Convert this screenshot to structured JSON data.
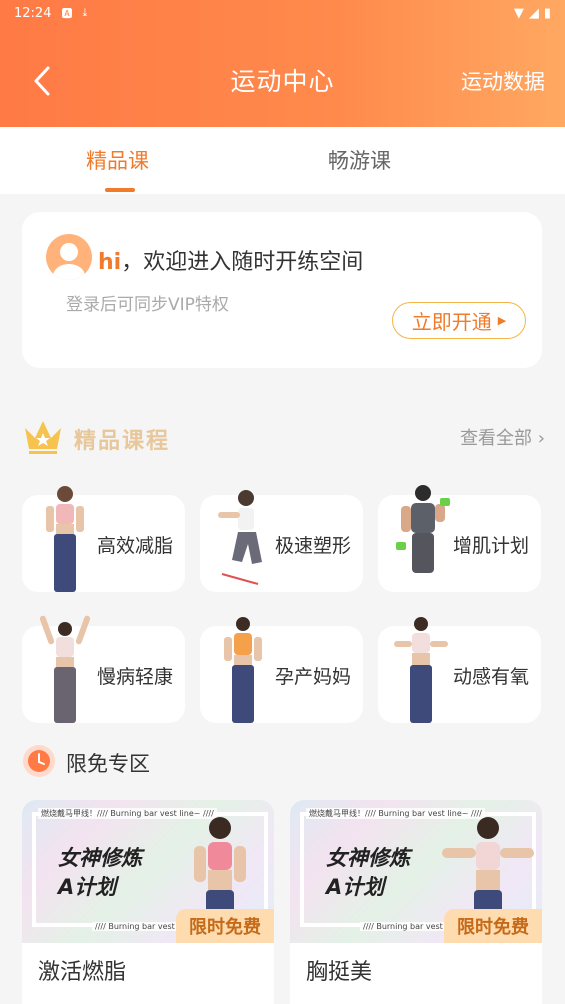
{
  "status_bar": {
    "time": "12:24"
  },
  "header": {
    "title": "运动中心",
    "right_link": "运动数据"
  },
  "tabs": [
    {
      "label": "精品课"
    },
    {
      "label": "畅游课"
    }
  ],
  "login_card": {
    "greeting_hi": "hi",
    "greeting_text": "，欢迎进入随时开练空间",
    "subtitle": "登录后可同步VIP特权",
    "button": "立即开通"
  },
  "premium_section": {
    "title": "精品课程",
    "view_all": "查看全部"
  },
  "categories": [
    {
      "label": "高效减脂"
    },
    {
      "label": "极速塑形"
    },
    {
      "label": "增肌计划"
    },
    {
      "label": "慢病轻康"
    },
    {
      "label": "孕产妈妈"
    },
    {
      "label": "动感有氧"
    }
  ],
  "free_section": {
    "title": "限免专区"
  },
  "promos": [
    {
      "banner_top": "燃烧戴马甲线！//// Burning bar vest line~ ////",
      "banner_line1": "女神修炼",
      "banner_line2": "A计划",
      "banner_bottom": "//// Burning bar vest li",
      "tag": "限时免费",
      "title": "激活燃脂"
    },
    {
      "banner_top": "燃烧戴马甲线！//// Burning bar vest line~ ////",
      "banner_line1": "女神修炼",
      "banner_line2": "A计划",
      "banner_bottom": "//// Burning bar vest li",
      "tag": "限时免费",
      "title": "胸挺美"
    }
  ],
  "colors": {
    "accent": "#f07b2a",
    "header_start": "#ff7a45",
    "header_end": "#ffa862",
    "gold": "#e8c79a"
  }
}
